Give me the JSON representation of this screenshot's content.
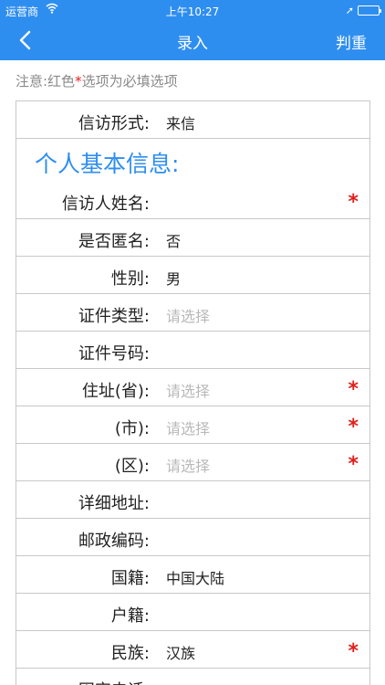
{
  "status": {
    "carrier": "运营商",
    "time": "上午10:27",
    "battery_level": 1.0
  },
  "nav": {
    "title": "录入",
    "action": "判重",
    "back_icon": "chevron-left-icon"
  },
  "notice": {
    "prefix": "注意:红色",
    "star": "*",
    "suffix": "选项为必填选项"
  },
  "form": {
    "letter_type": {
      "label": "信访形式:",
      "value": "来信"
    },
    "section_title": "个人基本信息:",
    "rows": [
      {
        "label": "信访人姓名:",
        "value": "",
        "placeholder": false,
        "required": true
      },
      {
        "label": "是否匿名:",
        "value": "否",
        "placeholder": false,
        "required": false
      },
      {
        "label": "性别:",
        "value": "男",
        "placeholder": false,
        "required": false
      },
      {
        "label": "证件类型:",
        "value": "请选择",
        "placeholder": true,
        "required": false
      },
      {
        "label": "证件号码:",
        "value": "",
        "placeholder": false,
        "required": false
      },
      {
        "label": "住址(省):",
        "value": "请选择",
        "placeholder": true,
        "required": true
      },
      {
        "label": "(市):",
        "value": "请选择",
        "placeholder": true,
        "required": true
      },
      {
        "label": "(区):",
        "value": "请选择",
        "placeholder": true,
        "required": true
      },
      {
        "label": "详细地址:",
        "value": "",
        "placeholder": false,
        "required": false
      },
      {
        "label": "邮政编码:",
        "value": "",
        "placeholder": false,
        "required": false
      },
      {
        "label": "国籍:",
        "value": "中国大陆",
        "placeholder": false,
        "required": false
      },
      {
        "label": "户籍:",
        "value": "",
        "placeholder": false,
        "required": false
      },
      {
        "label": "民族:",
        "value": "汉族",
        "placeholder": false,
        "required": true
      },
      {
        "label": "固定电话:",
        "value": "",
        "placeholder": false,
        "required": false
      }
    ],
    "required_mark": "*"
  },
  "colors": {
    "accent": "#2e8ef0",
    "required": "#e0201c",
    "placeholder": "#b9b9b9",
    "notice": "#8a8a8a"
  }
}
